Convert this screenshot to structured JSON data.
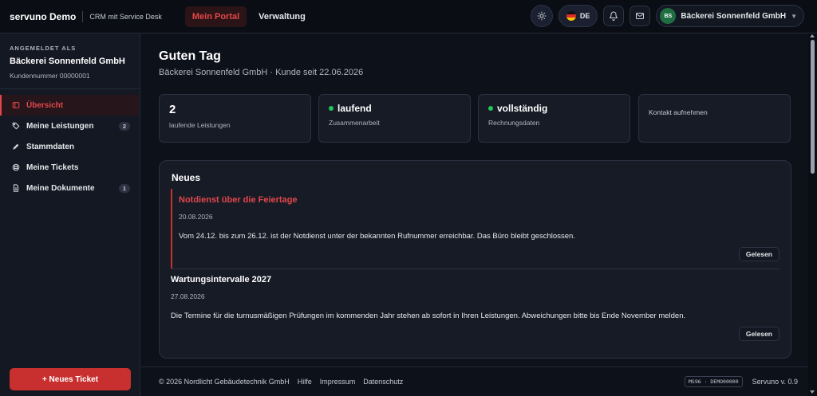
{
  "header": {
    "brand": "servuno Demo",
    "subtitle": "CRM mit Service Desk",
    "nav": [
      {
        "label": "Mein Portal",
        "active": true
      },
      {
        "label": "Verwaltung",
        "active": false
      }
    ],
    "language": "DE",
    "account": {
      "initials": "BS",
      "name": "Bäckerei Sonnenfeld GmbH"
    },
    "icons": {
      "theme": "sun-icon",
      "notifications": "bell-icon",
      "messages": "mail-icon",
      "account_menu": "chevron-down-icon"
    }
  },
  "sidebar": {
    "signed_in_label": "ANGEMELDET ALS",
    "company": "Bäckerei Sonnenfeld GmbH",
    "customer_number": "Kundennummer 00000001",
    "items": [
      {
        "label": "Übersicht",
        "icon": "overview-icon",
        "badge": "",
        "active": true
      },
      {
        "label": "Meine Leistungen",
        "icon": "tag-icon",
        "badge": "2",
        "active": false
      },
      {
        "label": "Stammdaten",
        "icon": "pencil-icon",
        "badge": "",
        "active": false
      },
      {
        "label": "Meine Tickets",
        "icon": "lifebuoy-icon",
        "badge": "",
        "active": false
      },
      {
        "label": "Meine Dokumente",
        "icon": "document-icon",
        "badge": "1",
        "active": false
      }
    ],
    "new_ticket_label": "+ Neues Ticket"
  },
  "main": {
    "greeting": "Guten Tag",
    "subgreeting": "Bäckerei Sonnenfeld GmbH · Kunde seit 22.06.2026",
    "stats": [
      {
        "value": "2",
        "label": "laufende Leistungen"
      },
      {
        "value": "laufend",
        "label": "Zusammenarbeit",
        "status_color": "#22c55e"
      },
      {
        "value": "vollständig",
        "label": "Rechnungsdaten",
        "status_color": "#22c55e"
      },
      {
        "label": "Kontakt aufnehmen"
      }
    ],
    "news": {
      "title": "Neues",
      "items": [
        {
          "title": "Notdienst über die Feiertage",
          "date": "20.08.2026",
          "text": "Vom 24.12. bis zum 26.12. ist der Notdienst unter der bekannten Rufnummer erreichbar. Das Büro bleibt geschlossen.",
          "button": "Gelesen"
        },
        {
          "title": "Wartungsintervalle 2027",
          "date": "27.08.2026",
          "text": "Die Termine für die turnusmäßigen Prüfungen im kommenden Jahr stehen ab sofort in Ihren Leistungen. Abweichungen bitte bis Ende November melden.",
          "button": "Gelesen"
        }
      ]
    }
  },
  "footer": {
    "copyright": "© 2026 Nordlicht Gebäudetechnik GmbH",
    "links": [
      "Hilfe",
      "Impressum",
      "Datenschutz"
    ],
    "build": "MS96 · DEMO00000",
    "version": "Servuno v. 0.9"
  },
  "colors": {
    "accent": "#e2474a",
    "primary_button": "#c8302f",
    "status_ok": "#22c55e",
    "background": "#0d111a"
  }
}
